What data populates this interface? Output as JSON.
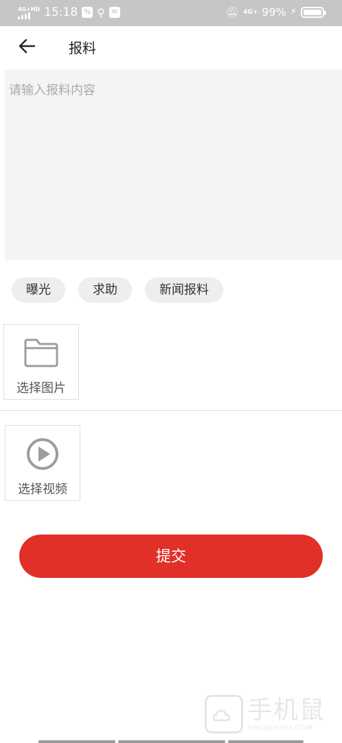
{
  "status_bar": {
    "network": "4G+HD",
    "time": "15:18",
    "right_network": "4G+",
    "battery": "99%",
    "battery_level": 0.99
  },
  "header": {
    "title": "报料"
  },
  "content": {
    "placeholder": "请输入报料内容",
    "value": ""
  },
  "tags": [
    "曝光",
    "求助",
    "新闻报料"
  ],
  "media": {
    "image_label": "选择图片",
    "video_label": "选择视频"
  },
  "submit_label": "提交",
  "watermark": {
    "cn": "手机鼠",
    "en": "SHOUJISHU.COM"
  },
  "colors": {
    "accent": "#e03028",
    "status_bar": "#c6c6c6"
  }
}
